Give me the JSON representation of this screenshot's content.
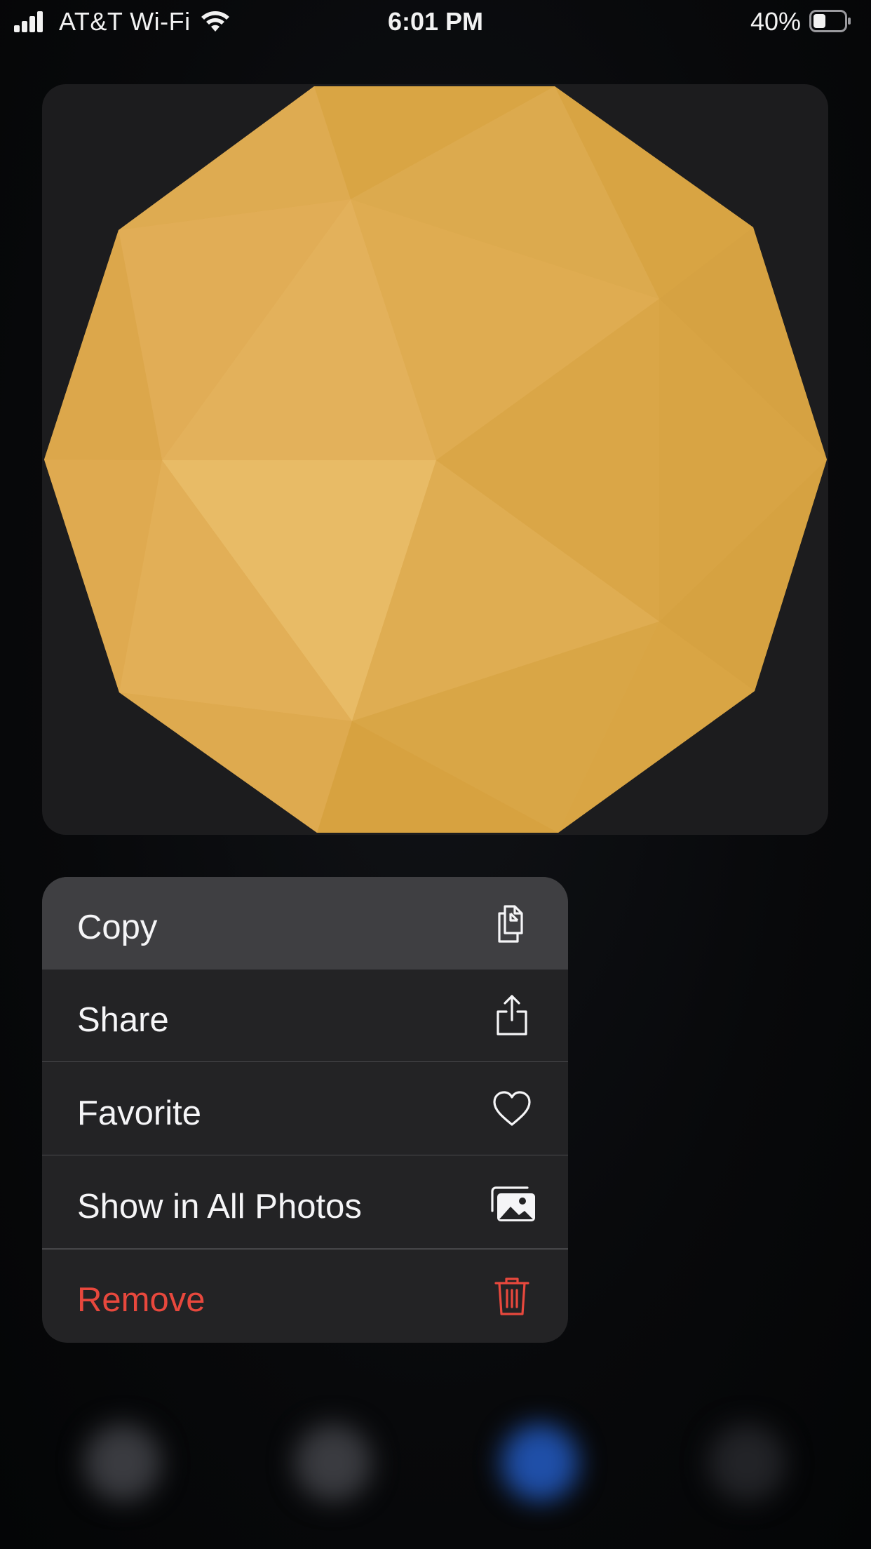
{
  "status_bar": {
    "carrier": "AT&T Wi-Fi",
    "time": "6:01 PM",
    "battery_percent": "40%",
    "battery_level": 0.4
  },
  "preview": {
    "fill_color": "#dfa94a",
    "background_color": "#1c1c1e"
  },
  "menu": {
    "items": [
      {
        "label": "Copy",
        "icon": "copy-icon",
        "highlighted": true
      },
      {
        "label": "Share",
        "icon": "share-icon"
      },
      {
        "label": "Favorite",
        "icon": "heart-icon"
      },
      {
        "label": "Show in All Photos",
        "icon": "photos-icon"
      },
      {
        "label": "Remove",
        "icon": "trash-icon",
        "destructive": true,
        "color": "#e8483d"
      }
    ]
  }
}
